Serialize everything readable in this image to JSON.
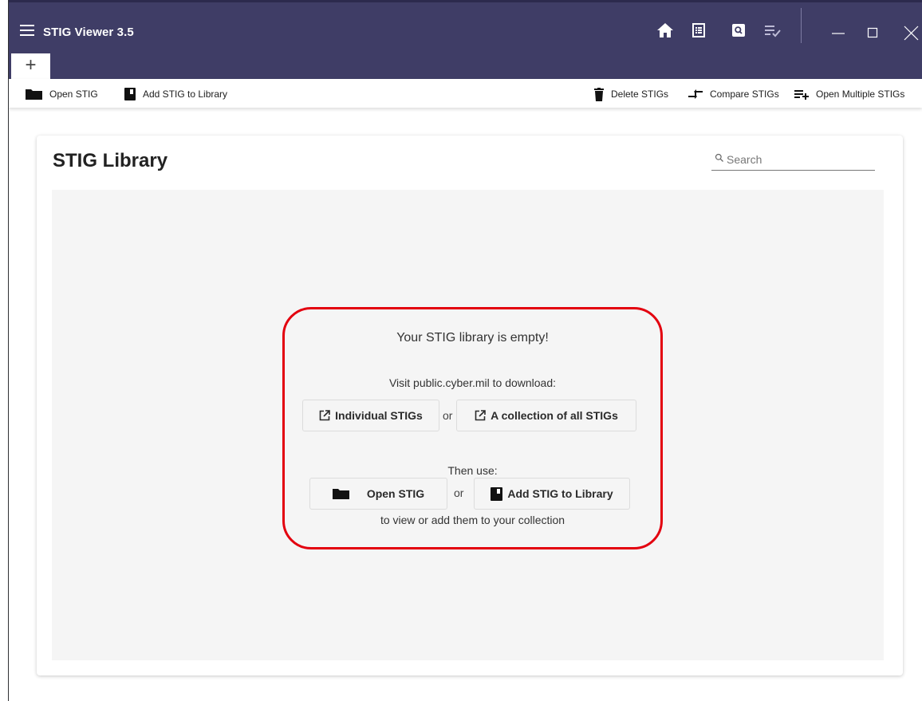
{
  "window": {
    "title": "STIG Viewer 3.5",
    "titlebar_color": "#3f3d66",
    "icons": [
      "menu-icon",
      "home-icon",
      "list-icon",
      "search-icon",
      "checklist-icon",
      "minimize-icon",
      "maximize-icon",
      "close-icon"
    ]
  },
  "tabs": {
    "add_label": "+"
  },
  "toolbar": {
    "open_stig": "Open STIG",
    "add_stig_to_library": "Add STIG to Library",
    "delete_stigs": "Delete STIGs",
    "compare_stigs": "Compare STIGs",
    "open_multiple_stigs": "Open Multiple STIGs"
  },
  "library": {
    "title": "STIG Library",
    "search_placeholder": "Search"
  },
  "empty_state": {
    "title": "Your STIG library is empty!",
    "visit_text": "Visit public.cyber.mil to download:",
    "individual_stigs": "Individual STIGs",
    "or": "or",
    "collection_all_stigs": "A collection of all STIGs",
    "then_use": "Then use:",
    "open_stig": "Open STIG",
    "add_stig_to_library": "Add STIG to Library",
    "view_add_text": "to view or add them to your collection",
    "highlight_color": "#e3000f"
  }
}
